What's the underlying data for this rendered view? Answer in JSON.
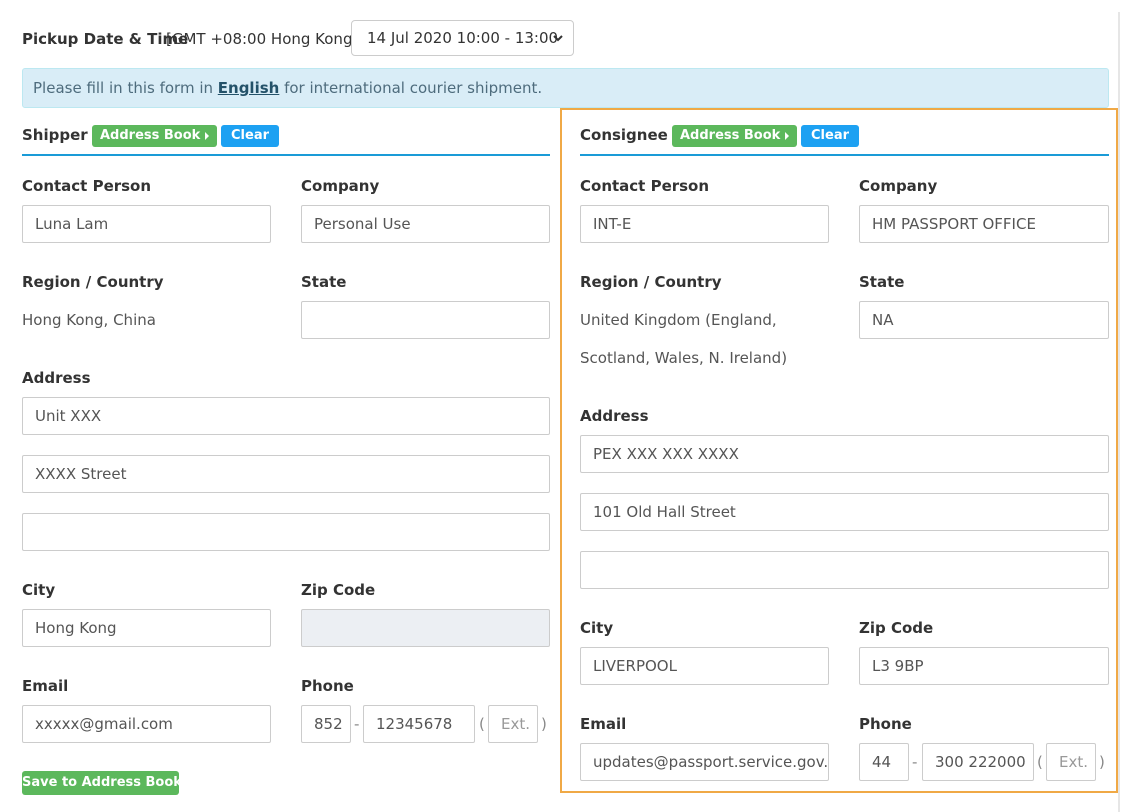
{
  "pickup": {
    "label": "Pickup Date & Time",
    "timezone": "[GMT +08:00 Hong Kong]",
    "selected": "14 Jul 2020 10:00 - 13:00"
  },
  "notice": {
    "before": "Please fill in this form in ",
    "link": "English",
    "after": " for international courier shipment."
  },
  "labels": {
    "contact_person": "Contact Person",
    "company": "Company",
    "region": "Region / Country",
    "state": "State",
    "address": "Address",
    "city": "City",
    "zip": "Zip Code",
    "email": "Email",
    "phone": "Phone",
    "phone_sep": "-",
    "paren_open": "(",
    "paren_close": ")"
  },
  "buttons": {
    "address_book": "Address Book",
    "clear": "Clear",
    "save_to_address_book": "Save to Address Book"
  },
  "shipper": {
    "title": "Shipper",
    "contact_person": "Luna Lam",
    "company": "Personal Use",
    "region_country": "Hong Kong, China",
    "state": "",
    "address_line1": "Unit XXX",
    "address_line2": "XXXX Street",
    "address_line3": "",
    "city": "Hong Kong",
    "zip": "",
    "email": "xxxxx@gmail.com",
    "phone_code": "852",
    "phone_number": "12345678",
    "ext_placeholder": "Ext."
  },
  "consignee": {
    "title": "Consignee",
    "contact_person": "INT-E",
    "company": "HM PASSPORT OFFICE",
    "region_line1": "United Kingdom (England,",
    "region_line2": "Scotland, Wales, N. Ireland)",
    "state": "NA",
    "address_line1": "PEX XXX XXX XXXX",
    "address_line2": "101 Old Hall Street",
    "address_line3": "",
    "city": "LIVERPOOL",
    "zip": "L3 9BP",
    "email": "updates@passport.service.gov.u",
    "phone_code": "44",
    "phone_number": "300 222000",
    "ext_placeholder": "Ext."
  },
  "colors": {
    "green": "#5cb85c",
    "blue": "#1da1f2",
    "highlight": "#f0a946",
    "notice_bg": "#d9edf7"
  }
}
